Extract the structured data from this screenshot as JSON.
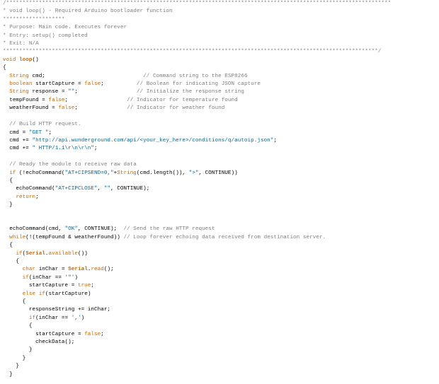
{
  "colors": {
    "background": "#ffffff",
    "comment": "#7e7e7e",
    "keyword": "#cc6600",
    "string": "#006699",
    "plain": "#000000"
  },
  "code_lines": [
    [
      [
        "comment",
        "/**********************************************************************************************************************"
      ]
    ],
    [
      [
        "comment",
        "* void loop() - Required Arduino bootloader function"
      ]
    ],
    [
      [
        "comment",
        "*******************"
      ]
    ],
    [
      [
        "comment",
        "* Purpose: Main code. Executes forever"
      ]
    ],
    [
      [
        "comment",
        "* Entry: setup() completed"
      ]
    ],
    [
      [
        "comment",
        "* Exit: N/A"
      ]
    ],
    [
      [
        "comment",
        "*******************************************************************************************************************/"
      ]
    ],
    [
      [
        "type",
        "void"
      ],
      [
        "plain",
        " "
      ],
      [
        "func",
        "loop"
      ],
      [
        "plain",
        "()"
      ]
    ],
    [
      [
        "plain",
        "{"
      ]
    ],
    [
      [
        "plain",
        "  "
      ],
      [
        "type",
        "String"
      ],
      [
        "plain",
        " cmd;                              "
      ],
      [
        "comment",
        "// Command string to the ESP8266"
      ]
    ],
    [
      [
        "plain",
        "  "
      ],
      [
        "type",
        "boolean"
      ],
      [
        "plain",
        " startCapture = "
      ],
      [
        "keyword",
        "false"
      ],
      [
        "plain",
        ";          "
      ],
      [
        "comment",
        "// Boolean for indicating JSON capture"
      ]
    ],
    [
      [
        "plain",
        "  "
      ],
      [
        "type",
        "String"
      ],
      [
        "plain",
        " response = "
      ],
      [
        "string",
        "\"\""
      ],
      [
        "plain",
        ";                  "
      ],
      [
        "comment",
        "// Initialize the response string"
      ]
    ],
    [
      [
        "plain",
        "  tempFound = "
      ],
      [
        "keyword",
        "false"
      ],
      [
        "plain",
        ";                  "
      ],
      [
        "comment",
        "// Indicator for temperature found"
      ]
    ],
    [
      [
        "plain",
        "  weatherFound = "
      ],
      [
        "keyword",
        "false"
      ],
      [
        "plain",
        ";               "
      ],
      [
        "comment",
        "// Indicator for weather found"
      ]
    ],
    [
      [
        "plain",
        ""
      ]
    ],
    [
      [
        "plain",
        "  "
      ],
      [
        "comment",
        "// Build HTTP request."
      ]
    ],
    [
      [
        "plain",
        "  cmd = "
      ],
      [
        "string",
        "\"GET \""
      ],
      [
        "plain",
        ";"
      ]
    ],
    [
      [
        "plain",
        "  cmd += "
      ],
      [
        "string",
        "\"http://api.wunderground.com/api/<your_key_here>/conditions/q/autoip.json\""
      ],
      [
        "plain",
        ";"
      ]
    ],
    [
      [
        "plain",
        "  cmd += "
      ],
      [
        "string",
        "\" HTTP/1.1\\r\\n\\r\\n\""
      ],
      [
        "plain",
        ";"
      ]
    ],
    [
      [
        "plain",
        ""
      ]
    ],
    [
      [
        "plain",
        "  "
      ],
      [
        "comment",
        "// Ready the module to receive raw data"
      ]
    ],
    [
      [
        "plain",
        "  "
      ],
      [
        "keyword",
        "if"
      ],
      [
        "plain",
        " (!echoCommand("
      ],
      [
        "string",
        "\"AT+CIPSEND=0,\""
      ],
      [
        "plain",
        "+"
      ],
      [
        "type",
        "String"
      ],
      [
        "plain",
        "(cmd.length()), "
      ],
      [
        "string",
        "\">\""
      ],
      [
        "plain",
        ", CONTINUE))"
      ]
    ],
    [
      [
        "plain",
        "  {"
      ]
    ],
    [
      [
        "plain",
        "    echoCommand("
      ],
      [
        "string",
        "\"AT+CIPCLOSE\""
      ],
      [
        "plain",
        ", "
      ],
      [
        "string",
        "\"\""
      ],
      [
        "plain",
        ", CONTINUE);"
      ]
    ],
    [
      [
        "plain",
        "    "
      ],
      [
        "keyword",
        "return"
      ],
      [
        "plain",
        ";"
      ]
    ],
    [
      [
        "plain",
        "  }"
      ]
    ],
    [
      [
        "plain",
        ""
      ]
    ],
    [
      [
        "plain",
        ""
      ]
    ],
    [
      [
        "plain",
        "  echoCommand(cmd, "
      ],
      [
        "string",
        "\"OK\""
      ],
      [
        "plain",
        ", CONTINUE);  "
      ],
      [
        "comment",
        "// Send the raw HTTP request"
      ]
    ],
    [
      [
        "plain",
        "  "
      ],
      [
        "keyword",
        "while"
      ],
      [
        "plain",
        "(!(tempFound & weatherFound)) "
      ],
      [
        "comment",
        "// Loop forever echoing data received from destination server."
      ]
    ],
    [
      [
        "plain",
        "  {"
      ]
    ],
    [
      [
        "plain",
        "    "
      ],
      [
        "keyword",
        "if"
      ],
      [
        "plain",
        "("
      ],
      [
        "builtin",
        "Serial"
      ],
      [
        "plain",
        "."
      ],
      [
        "keyword",
        "available"
      ],
      [
        "plain",
        "())"
      ]
    ],
    [
      [
        "plain",
        "    {"
      ]
    ],
    [
      [
        "plain",
        "      "
      ],
      [
        "type",
        "char"
      ],
      [
        "plain",
        " inChar = "
      ],
      [
        "builtin",
        "Serial"
      ],
      [
        "plain",
        "."
      ],
      [
        "keyword",
        "read"
      ],
      [
        "plain",
        "();"
      ]
    ],
    [
      [
        "plain",
        "      "
      ],
      [
        "keyword",
        "if"
      ],
      [
        "plain",
        "(inChar == "
      ],
      [
        "string",
        "'\"'"
      ],
      [
        "plain",
        ")"
      ]
    ],
    [
      [
        "plain",
        "        startCapture = "
      ],
      [
        "keyword",
        "true"
      ],
      [
        "plain",
        ";"
      ]
    ],
    [
      [
        "plain",
        "      "
      ],
      [
        "keyword",
        "else"
      ],
      [
        "plain",
        " "
      ],
      [
        "keyword",
        "if"
      ],
      [
        "plain",
        "(startCapture)"
      ]
    ],
    [
      [
        "plain",
        "      {"
      ]
    ],
    [
      [
        "plain",
        "        responseString += inChar;"
      ]
    ],
    [
      [
        "plain",
        "        "
      ],
      [
        "keyword",
        "if"
      ],
      [
        "plain",
        "(inChar == "
      ],
      [
        "string",
        "','"
      ],
      [
        "plain",
        ")"
      ]
    ],
    [
      [
        "plain",
        "        {"
      ]
    ],
    [
      [
        "plain",
        "          startCapture = "
      ],
      [
        "keyword",
        "false"
      ],
      [
        "plain",
        ";"
      ]
    ],
    [
      [
        "plain",
        "          checkData();"
      ]
    ],
    [
      [
        "plain",
        "        }"
      ]
    ],
    [
      [
        "plain",
        "      }"
      ]
    ],
    [
      [
        "plain",
        "    }"
      ]
    ],
    [
      [
        "plain",
        "  }"
      ]
    ]
  ]
}
